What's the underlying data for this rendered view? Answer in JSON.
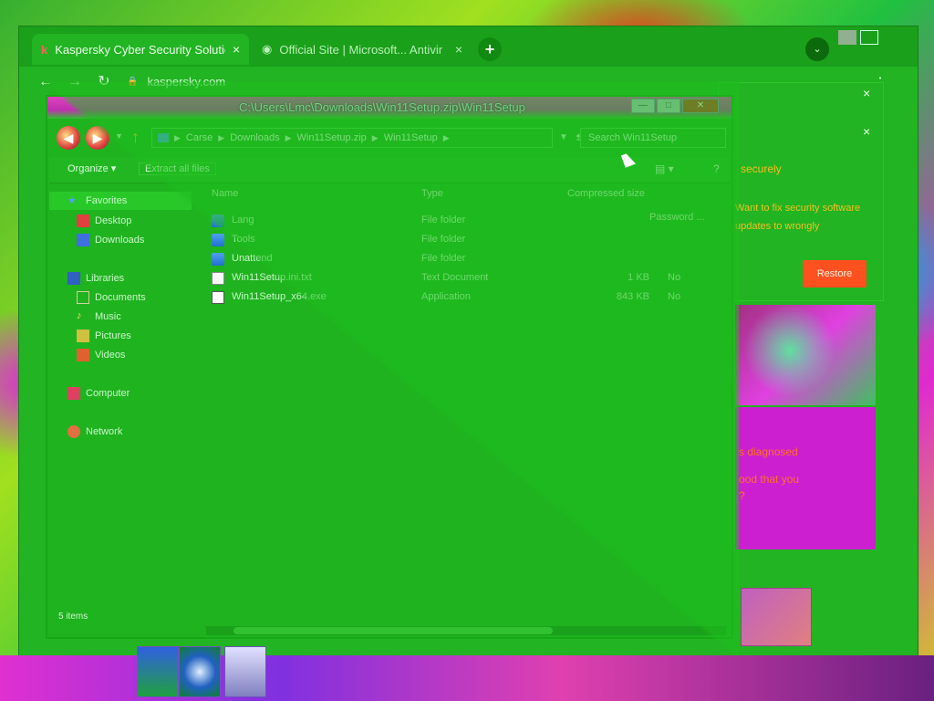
{
  "browser": {
    "tabs": [
      {
        "label": "Kaspersky Cyber Security Solutio",
        "icon": "kaspersky-k-icon",
        "active": true
      },
      {
        "label": "Official Site | Microsoft... Antivir",
        "icon": "globe-icon",
        "active": false
      }
    ],
    "new_tab": "+",
    "address": "kaspersky.com",
    "close_glyph": "×",
    "menu_glyph": "⋮",
    "profile_label": "⌄",
    "back_glyph": "←",
    "forward_glyph": "→",
    "reload_glyph": "↻",
    "lock_glyph": "🔒"
  },
  "side_panel": {
    "heading": "securely",
    "text": "Want to fix security software updates to wrongly",
    "button": "Restore",
    "links": [
      "s diagnosed",
      "ood that you",
      "?"
    ],
    "close_glyph": "×"
  },
  "explorer": {
    "title": "C:\\Users\\Lmc\\Downloads\\Win11Setup.zip\\Win11Setup",
    "breadcrumb": [
      "Carse",
      "Downloads",
      "Win11Setup.zip",
      "Win11Setup"
    ],
    "search_placeholder": "Search Win11Setup",
    "commands": {
      "organize": "Organize ▾",
      "extract": "Extract all files"
    },
    "controls": {
      "minimize": "—",
      "maximize": "□",
      "close": "✕"
    },
    "nav": [
      {
        "label": "Favorites",
        "icon": "star-icon",
        "indent": 0,
        "selected": true
      },
      {
        "label": "Desktop",
        "icon": "desktop-icon",
        "indent": 1
      },
      {
        "label": "Downloads",
        "icon": "downloads-icon",
        "indent": 1
      },
      {
        "label": "Libraries",
        "icon": "library-icon",
        "indent": 0
      },
      {
        "label": "Documents",
        "icon": "documents-icon",
        "indent": 1
      },
      {
        "label": "Music",
        "icon": "music-icon",
        "indent": 1
      },
      {
        "label": "Pictures",
        "icon": "pictures-icon",
        "indent": 1
      },
      {
        "label": "Videos",
        "icon": "videos-icon",
        "indent": 1
      },
      {
        "label": "Computer",
        "icon": "computer-icon",
        "indent": 0
      },
      {
        "label": "Network",
        "icon": "network-icon",
        "indent": 0
      }
    ],
    "columns": {
      "name": "Name",
      "type": "Type",
      "compressed": "Compressed size",
      "password": "Password ..."
    },
    "files": [
      {
        "name": "Lang",
        "type": "File folder",
        "compressed": "",
        "password": "",
        "icon": "folder-icon"
      },
      {
        "name": "Tools",
        "type": "File folder",
        "compressed": "",
        "password": "",
        "icon": "folder-icon"
      },
      {
        "name": "Unattend",
        "type": "File folder",
        "compressed": "",
        "password": "",
        "icon": "folder-icon"
      },
      {
        "name": "Win11Setup.ini.txt",
        "type": "Text Document",
        "compressed": "1 KB",
        "password": "No",
        "icon": "text-document-icon"
      },
      {
        "name": "Win11Setup_x64.exe",
        "type": "Application",
        "compressed": "843 KB",
        "password": "No",
        "icon": "application-icon"
      }
    ],
    "status": "5 items"
  },
  "colors": {
    "window_green": "#22b422",
    "accent_orange": "#ff5020",
    "title_magenta": "#e040c0"
  }
}
